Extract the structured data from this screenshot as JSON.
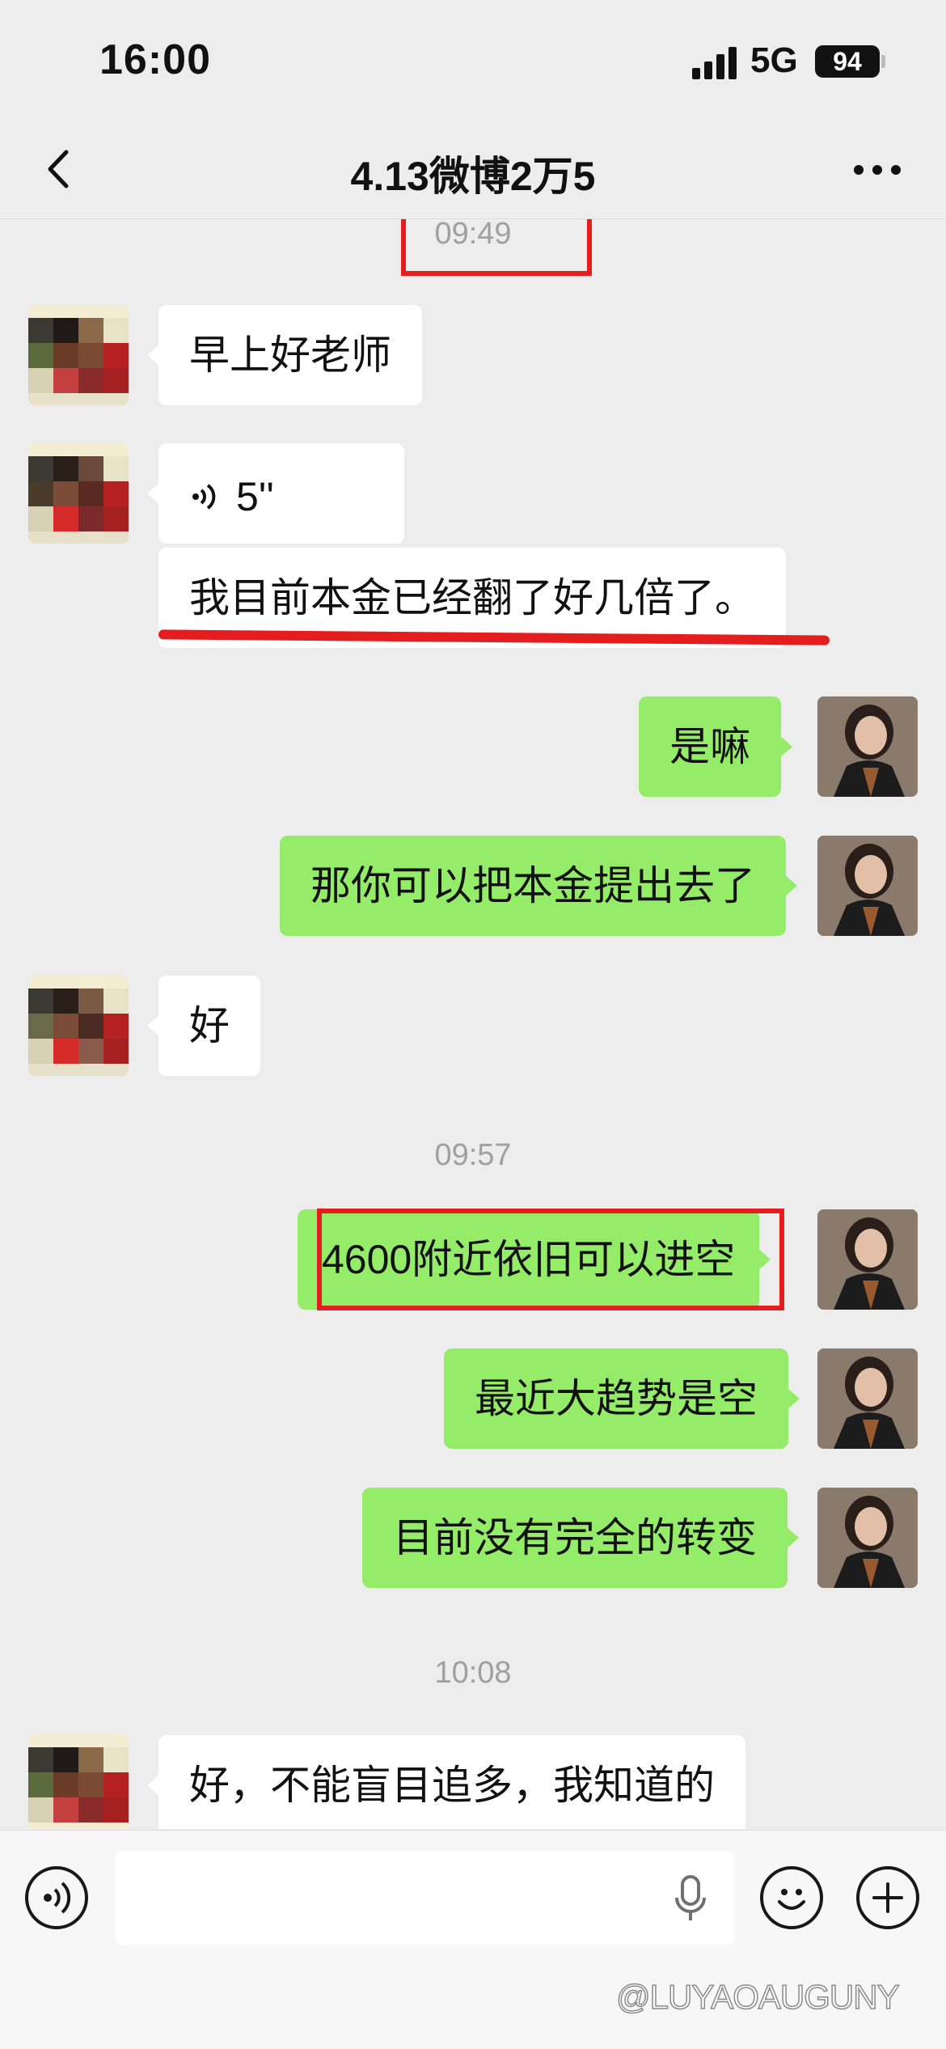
{
  "status_bar": {
    "time": "16:00",
    "network": "5G",
    "battery": "94"
  },
  "nav": {
    "title": "4.13微博2万5"
  },
  "chat": {
    "timestamps": [
      "09:49",
      "09:57",
      "10:08"
    ],
    "messages": [
      {
        "side": "in",
        "type": "text",
        "text": "早上好老师"
      },
      {
        "side": "in",
        "type": "voice",
        "duration": "5''"
      },
      {
        "side": "in",
        "type": "text",
        "text": "我目前本金已经翻了好几倍了。"
      },
      {
        "side": "out",
        "type": "text",
        "text": "是嘛"
      },
      {
        "side": "out",
        "type": "text",
        "text": "那你可以把本金提出去了"
      },
      {
        "side": "in",
        "type": "text",
        "text": "好"
      },
      {
        "side": "out",
        "type": "text",
        "text": "4600附近依旧可以进空"
      },
      {
        "side": "out",
        "type": "text",
        "text": "最近大趋势是空"
      },
      {
        "side": "out",
        "type": "text",
        "text": "目前没有完全的转变"
      },
      {
        "side": "in",
        "type": "text",
        "text": "好，不能盲目追多，我知道的"
      }
    ]
  },
  "input": {
    "value": "",
    "placeholder": ""
  },
  "icons": {
    "back": "chevron-left-icon",
    "more": "more-dots-icon",
    "voice_toggle": "voice-mode-icon",
    "mic": "microphone-icon",
    "emoji": "emoji-icon",
    "add": "plus-icon"
  },
  "colors": {
    "background": "#ededed",
    "outgoing_bubble": "#95ec69",
    "incoming_bubble": "#ffffff",
    "annotation": "#e41e1e"
  },
  "watermark": "@LUYAOAUGUNY"
}
